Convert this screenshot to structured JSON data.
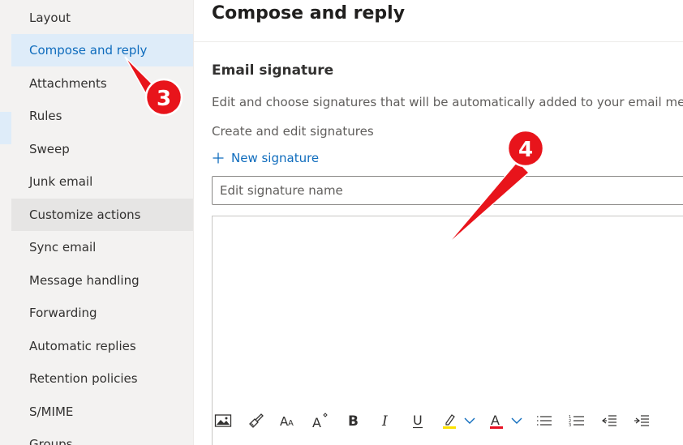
{
  "sidebar": {
    "items": [
      {
        "label": "Layout"
      },
      {
        "label": "Compose and reply"
      },
      {
        "label": "Attachments"
      },
      {
        "label": "Rules"
      },
      {
        "label": "Sweep"
      },
      {
        "label": "Junk email"
      },
      {
        "label": "Customize actions"
      },
      {
        "label": "Sync email"
      },
      {
        "label": "Message handling"
      },
      {
        "label": "Forwarding"
      },
      {
        "label": "Automatic replies"
      },
      {
        "label": "Retention policies"
      },
      {
        "label": "S/MIME"
      },
      {
        "label": "Groups"
      }
    ]
  },
  "main": {
    "title": "Compose and reply",
    "section_title": "Email signature",
    "description": "Edit and choose signatures that will be automatically added to your email message.",
    "create_label": "Create and edit signatures",
    "new_signature_label": "New signature",
    "signature_name_placeholder": "Edit signature name",
    "toolbar_icons": [
      "insert-image-icon",
      "format-painter-icon",
      "font-size-icon",
      "text-effects-icon",
      "bold-icon",
      "italic-icon",
      "underline-icon",
      "highlight-icon",
      "chevron-down-icon",
      "font-color-icon",
      "chevron-down-icon",
      "bullets-icon",
      "numbering-icon",
      "decrease-indent-icon",
      "increase-indent-icon"
    ]
  },
  "annotations": {
    "step_3": "3",
    "step_4": "4"
  },
  "colors": {
    "accent": "#0f6cbd",
    "selected_bg": "#deecf9",
    "callout_red": "#e8141b",
    "highlight_yellow": "#fce100",
    "font_color_red": "#e81123"
  }
}
